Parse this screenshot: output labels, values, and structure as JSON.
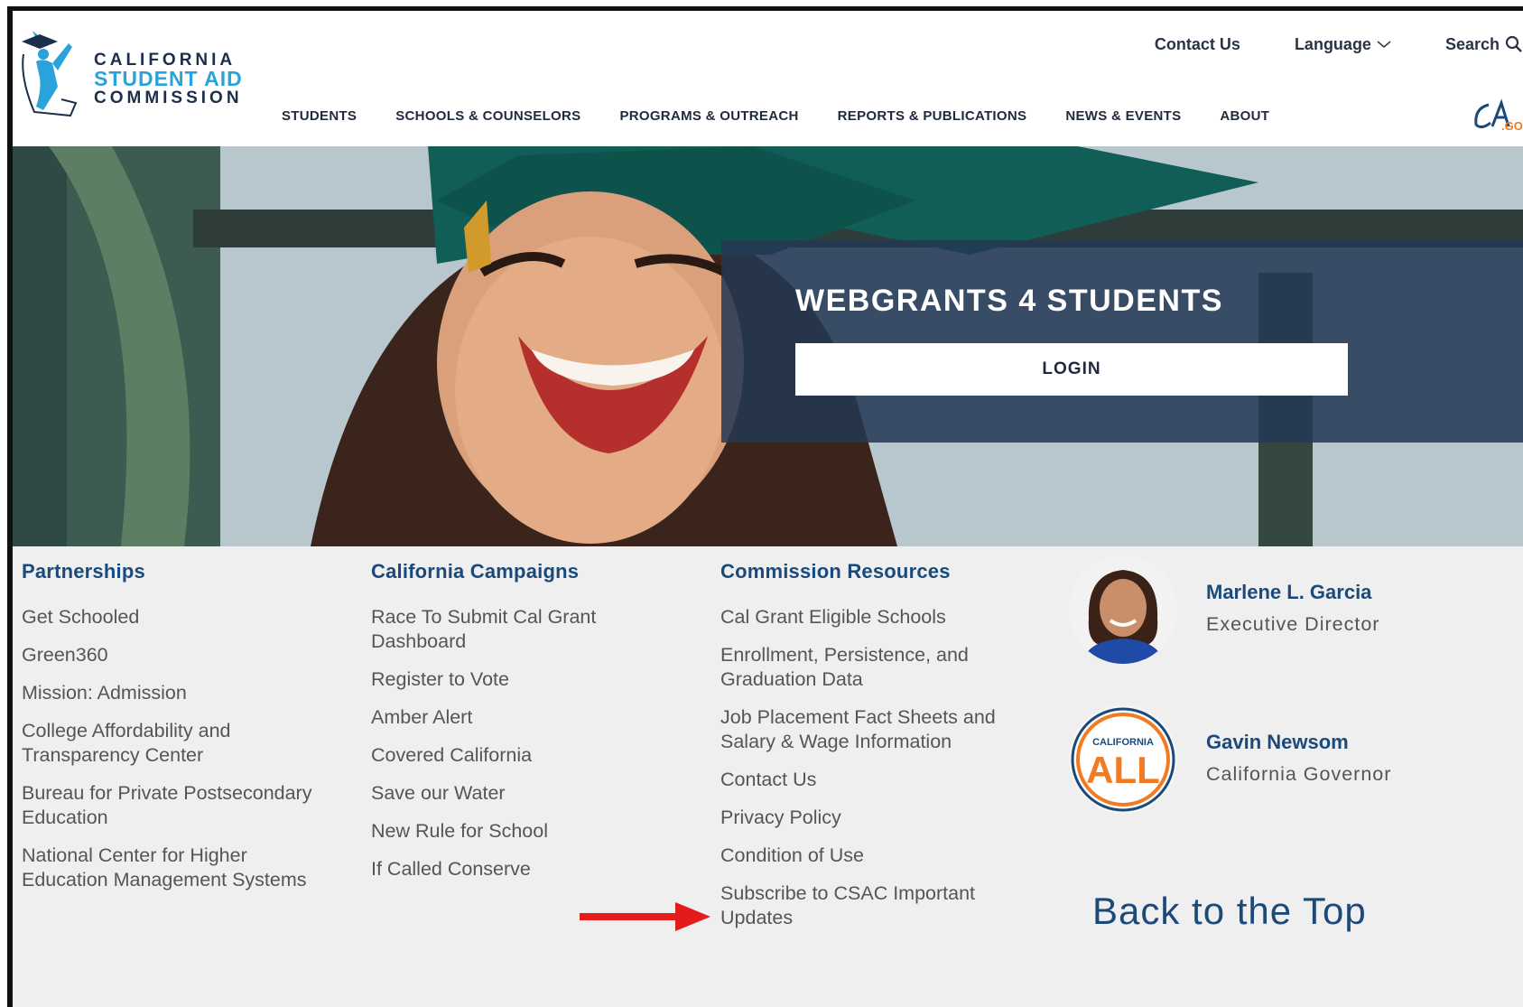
{
  "header": {
    "logo": {
      "line1": "CALIFORNIA",
      "line2": "STUDENT AID",
      "line3": "COMMISSION"
    },
    "utility": {
      "contact": "Contact Us",
      "language": "Language",
      "search": "Search"
    },
    "nav": [
      "STUDENTS",
      "SCHOOLS & COUNSELORS",
      "PROGRAMS & OUTREACH",
      "REPORTS & PUBLICATIONS",
      "NEWS & EVENTS",
      "ABOUT"
    ],
    "ca_gov_logo": "CA.GOV"
  },
  "hero": {
    "title": "WEBGRANTS 4 STUDENTS",
    "login_label": "LOGIN"
  },
  "footer": {
    "columns": [
      {
        "title": "Partnerships",
        "items": [
          "Get Schooled",
          "Green360",
          "Mission: Admission",
          "College Affordability and Transparency Center",
          "Bureau for Private Postsecondary Education",
          "National Center for Higher Education Management Systems"
        ]
      },
      {
        "title": "California Campaigns",
        "items": [
          "Race To Submit Cal Grant Dashboard",
          "Register to Vote",
          "Amber Alert",
          "Covered California",
          "Save our Water",
          "New Rule for School",
          "If Called Conserve"
        ]
      },
      {
        "title": "Commission Resources",
        "items": [
          "Cal Grant Eligible Schools",
          "Enrollment, Persistence, and Graduation Data",
          "Job Placement Fact Sheets and Salary & Wage Information",
          "Contact Us",
          "Privacy Policy",
          "Condition of Use",
          "Subscribe to CSAC Important Updates"
        ]
      }
    ],
    "people": [
      {
        "name": "Marlene L. Garcia",
        "title": "Executive Director"
      },
      {
        "name": "Gavin Newsom",
        "title": "California Governor",
        "badge_top": "CALIFORNIA",
        "badge_main": "ALL"
      }
    ],
    "back_to_top": "Back to the Top"
  },
  "colors": {
    "navy": "#243854",
    "link_blue": "#1b4a7a",
    "accent_cyan": "#2aa3da",
    "arrow_red": "#e31b1b",
    "badge_orange": "#f07b22"
  }
}
